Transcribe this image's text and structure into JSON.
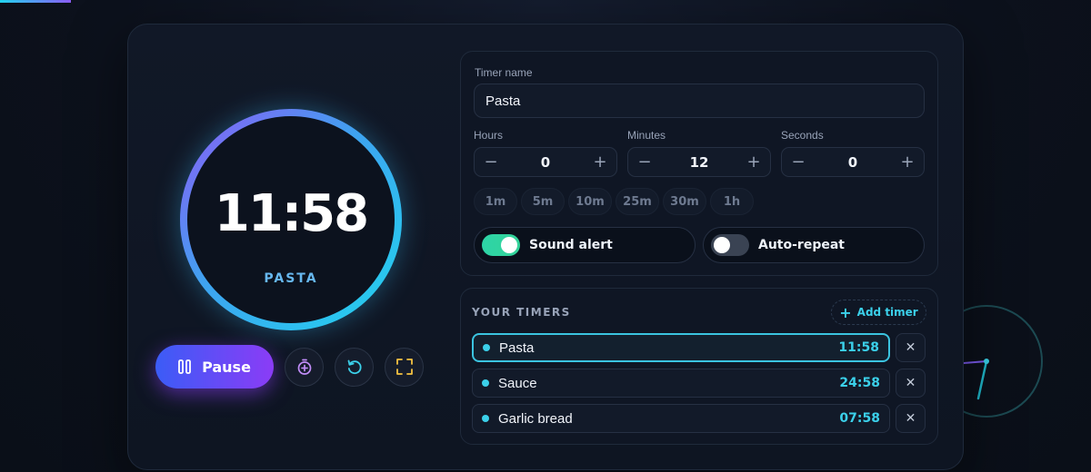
{
  "app": {
    "timer": {
      "time": "11:58",
      "name_display": "PASTA",
      "progress": 0.998
    },
    "controls": {
      "pause_label": "Pause"
    },
    "form": {
      "name_label": "Timer name",
      "name_value": "Pasta",
      "hours": {
        "label": "Hours",
        "value": "0"
      },
      "minutes": {
        "label": "Minutes",
        "value": "12"
      },
      "seconds": {
        "label": "Seconds",
        "value": "0"
      },
      "presets": [
        "1m",
        "5m",
        "10m",
        "25m",
        "30m",
        "1h"
      ],
      "sound_alert": {
        "label": "Sound alert",
        "on": true
      },
      "auto_repeat": {
        "label": "Auto-repeat",
        "on": false
      }
    },
    "list": {
      "heading": "YOUR TIMERS",
      "add_label": "Add timer",
      "items": [
        {
          "name": "Pasta",
          "time": "11:58",
          "active": true
        },
        {
          "name": "Sauce",
          "time": "24:58",
          "active": false
        },
        {
          "name": "Garlic bread",
          "time": "07:58",
          "active": false
        }
      ]
    },
    "colors": {
      "accent_cyan": "#22d3ee",
      "accent_purple": "#8b5cf6",
      "toggle_on": "#34d399"
    }
  }
}
